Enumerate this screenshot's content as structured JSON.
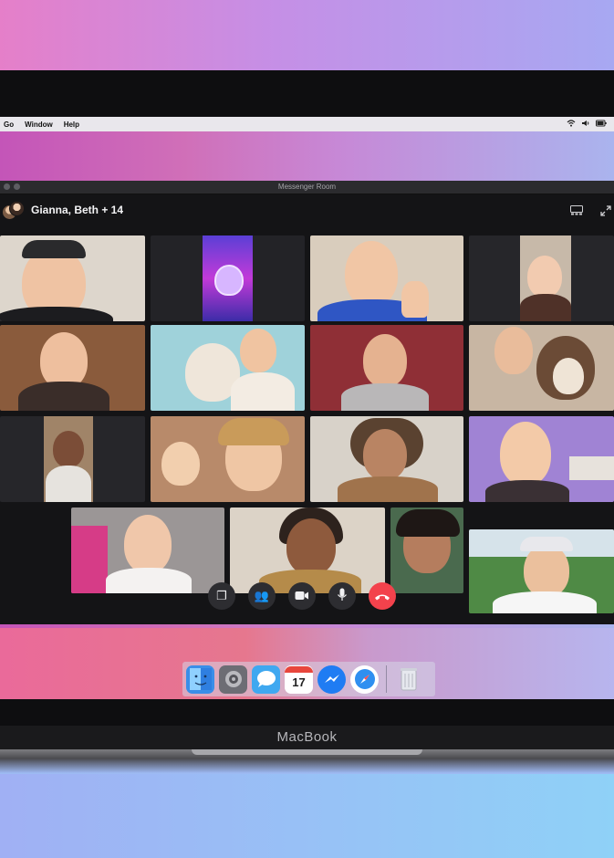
{
  "menubar": {
    "items": [
      "Go",
      "Window",
      "Help"
    ],
    "status_icons": [
      "wifi-icon",
      "volume-icon",
      "battery-icon"
    ]
  },
  "window": {
    "title": "Messenger Room"
  },
  "call": {
    "group_name": "Gianna, Beth + 14",
    "header_icons": [
      "gallery-view-icon",
      "fullscreen-icon"
    ],
    "controls": [
      {
        "name": "share-screen-button",
        "icon": "share-screen-icon",
        "glyph": "❐"
      },
      {
        "name": "participants-button",
        "icon": "participants-icon",
        "glyph": "👥"
      },
      {
        "name": "camera-button",
        "icon": "camera-icon",
        "glyph": "▶"
      },
      {
        "name": "microphone-button",
        "icon": "microphone-icon",
        "glyph": "🎙"
      },
      {
        "name": "end-call-button",
        "icon": "end-call-icon",
        "glyph": "☎"
      }
    ],
    "colors": {
      "end_call": "#f3424c",
      "window_bg": "#141416"
    }
  },
  "dock": {
    "apps": [
      {
        "name": "finder",
        "icon": "finder-icon",
        "glyph": "☺",
        "bg": "#3a8ee8",
        "fg": "#ffffff"
      },
      {
        "name": "system-preferences",
        "icon": "gear-icon",
        "glyph": "⚙",
        "bg": "#6d6d74",
        "fg": "#e8e8ea"
      },
      {
        "name": "messages",
        "icon": "messages-icon",
        "glyph": "💬",
        "bg": "#3fa8f0",
        "fg": "#ffffff"
      },
      {
        "name": "calendar",
        "icon": "calendar-icon",
        "glyph": "17",
        "bg": "#ffffff",
        "fg": "#222222"
      },
      {
        "name": "messenger",
        "icon": "messenger-icon",
        "glyph": "⚡",
        "bg": "#1f7cf3",
        "fg": "#ffffff"
      },
      {
        "name": "safari",
        "icon": "safari-icon",
        "glyph": "✦",
        "bg": "#2f8ff0",
        "fg": "#ffffff"
      },
      {
        "name": "trash",
        "icon": "trash-icon",
        "glyph": "▯",
        "bg": "#d8dbe2",
        "fg": "#9a9ca4"
      }
    ]
  },
  "device": {
    "brand": "MacBook"
  }
}
